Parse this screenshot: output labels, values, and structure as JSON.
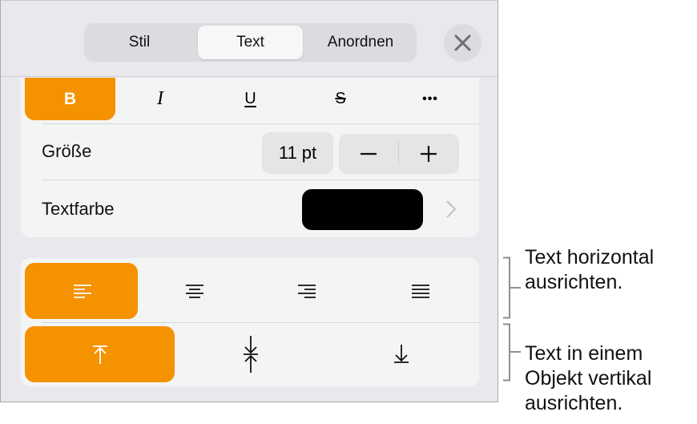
{
  "toolbar": {
    "tabs": [
      {
        "label": "Stil",
        "selected": false
      },
      {
        "label": "Text",
        "selected": true
      },
      {
        "label": "Anordnen",
        "selected": false
      }
    ],
    "close_icon": "close-icon"
  },
  "format": {
    "buttons": [
      {
        "label": "B",
        "name": "bold",
        "active": true
      },
      {
        "label": "I",
        "name": "italic",
        "active": false
      },
      {
        "label": "U",
        "name": "underline",
        "active": false
      },
      {
        "label": "S",
        "name": "strikethrough",
        "active": false
      },
      {
        "label": "•••",
        "name": "more",
        "active": false
      }
    ]
  },
  "size": {
    "label": "Größe",
    "value": "11 pt",
    "decrement_icon": "minus-icon",
    "increment_icon": "plus-icon"
  },
  "text_color": {
    "label": "Textfarbe",
    "color": "#000000",
    "chevron_icon": "chevron-right-icon"
  },
  "horizontal_alignment": {
    "options": [
      "left",
      "center",
      "right",
      "justify"
    ],
    "selected": "left"
  },
  "vertical_alignment": {
    "options": [
      "top",
      "middle",
      "bottom"
    ],
    "selected": "top"
  },
  "callouts": {
    "horizontal": [
      "Text horizontal",
      "ausrichten."
    ],
    "vertical": [
      "Text in einem",
      "Objekt vertikal",
      "ausrichten."
    ]
  },
  "colors": {
    "accent": "#f59200",
    "panel_bg": "#e9e8ed",
    "card_bg": "#f3f4f4"
  }
}
